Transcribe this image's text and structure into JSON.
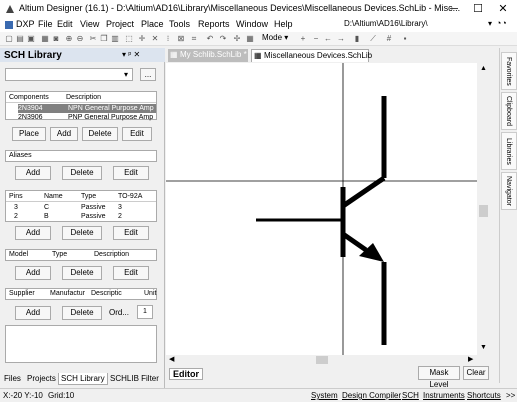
{
  "window": {
    "title": "Altium Designer (16.1) - D:\\Altium\\AD16\\Library\\Miscellaneous Devices\\Miscellaneous Devices.SchLib - Misc...",
    "minimize": "─",
    "maximize": "☐",
    "close": "✕"
  },
  "menu": {
    "items": [
      "DXP",
      "File",
      "Edit",
      "View",
      "Project",
      "Place",
      "Tools",
      "Reports",
      "Window",
      "Help"
    ],
    "path": "D:\\Altium\\AD16\\Library\\"
  },
  "toolbar": {
    "mode_label": "Mode ▾"
  },
  "panel": {
    "title": "SCH Library",
    "pin_icons": "▾ ᵖ ✕",
    "filter_btn": "...",
    "components": {
      "headers": [
        "Components",
        "Description"
      ],
      "rows": [
        {
          "name": "2N3904",
          "desc": "NPN General Purpose Amp"
        },
        {
          "name": "2N3906",
          "desc": "PNP General Purpose Amp"
        }
      ]
    },
    "comp_buttons": [
      "Place",
      "Add",
      "Delete",
      "Edit"
    ],
    "aliases_label": "Aliases",
    "alias_buttons": [
      "Add",
      "Delete",
      "Edit"
    ],
    "pins": {
      "headers": [
        "Pins",
        "Name",
        "Type",
        "TO-92A"
      ],
      "rows": [
        {
          "pin": "3",
          "name": "C",
          "type": "Passive",
          "num": "3"
        },
        {
          "pin": "2",
          "name": "B",
          "type": "Passive",
          "num": "2"
        }
      ]
    },
    "pin_buttons": [
      "Add",
      "Delete",
      "Edit"
    ],
    "model": {
      "headers": [
        "Model",
        "Type",
        "Description"
      ]
    },
    "model_buttons": [
      "Add",
      "Delete",
      "Edit"
    ],
    "supplier": {
      "headers": [
        "Supplier",
        "Manufactur",
        "Descriptic",
        "Unit"
      ]
    },
    "supplier_buttons": [
      "Add",
      "Delete",
      "Ord..."
    ],
    "order_value": "1"
  },
  "left_tabs": [
    "Files",
    "Projects",
    "SCH Library",
    "SCHLIB Filter"
  ],
  "doc_tabs": [
    "My Schlib.SchLib *",
    "Miscellaneous Devices.SchLib"
  ],
  "editor": {
    "label": "Editor",
    "mask_level": "Mask Level",
    "clear": "Clear"
  },
  "right_tabs": [
    "Favorites",
    "Clipboard",
    "Libraries",
    "Navigator"
  ],
  "status": {
    "coords": "X:-20 Y:-10",
    "grid": "Grid:10",
    "items": [
      "System",
      "Design Compiler",
      "SCH",
      "Instruments",
      "Shortcuts",
      ">>"
    ]
  },
  "colors": {
    "accent": "#0a3d7a",
    "panel_header": "#dce4ef",
    "wire": "#000000",
    "selected_row": "#808080"
  }
}
